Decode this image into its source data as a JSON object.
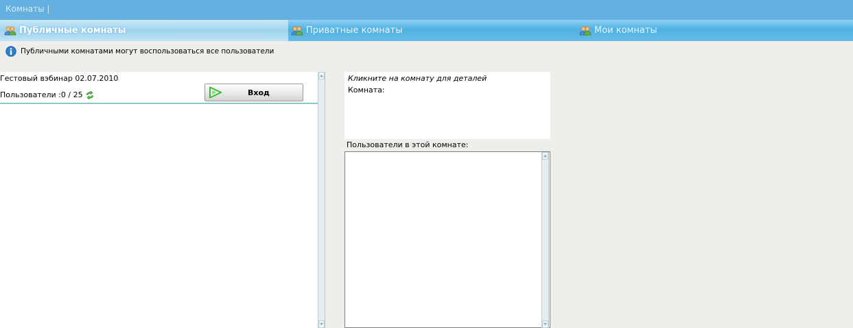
{
  "window": {
    "title": "Комнаты  |"
  },
  "tabs": [
    {
      "label": "Публичные комнаты",
      "icon": "users-icon",
      "active": true
    },
    {
      "label": "Приватные комнаты",
      "icon": "users-icon",
      "active": false
    },
    {
      "label": "Мои комнаты",
      "icon": "users-icon",
      "active": false
    }
  ],
  "info": {
    "icon": "info-icon",
    "text": "Публичными комнатами могут воспользоваться все пользователи"
  },
  "rooms": [
    {
      "name": "Гестовый вэбинар 02.07.2010",
      "users_label": "Пользователи :0 / 25",
      "enter_label": "Вход"
    }
  ],
  "details": {
    "hint": "Кликните на комнату для деталей",
    "room_label": "Комната:",
    "users_label": "Пользователи в этой комнате:"
  },
  "colors": {
    "titlebar": "#64b0e0",
    "tab_active": "#a0d4ee",
    "tab_inactive": "#4fb0e0",
    "background": "#eeeeea",
    "row_divider": "#8cc8c0",
    "play_green": "#2fbf2a"
  }
}
